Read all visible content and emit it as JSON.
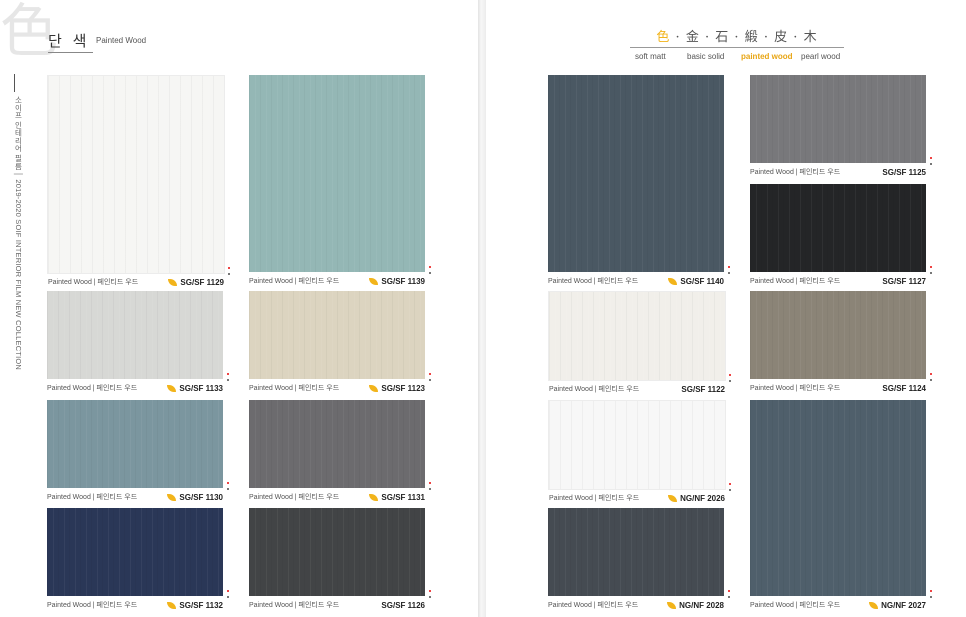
{
  "left_page": {
    "big_char": "色",
    "section_title": "단 색",
    "section_subtitle": "Painted Wood",
    "vertical_text": "소이프 인테리어 필름 │ 2019-2020 SOIF INTERIOR FILM NEW COLLECTION"
  },
  "right_page": {
    "categories_hanja": [
      "色",
      "金",
      "石",
      "緞",
      "皮",
      "木"
    ],
    "category_sep": "·",
    "categories": [
      "soft matt",
      "basic solid",
      "painted wood",
      "pearl wood"
    ],
    "active_category": "painted wood"
  },
  "caption_brand": "Painted Wood  |  페인티드 우드",
  "swatches": [
    {
      "id": "s1129",
      "code": "SG/SF 1129",
      "color": "#f6f6f4",
      "eco": true
    },
    {
      "id": "s1139",
      "code": "SG/SF 1139",
      "color": "#94b7b5",
      "eco": true
    },
    {
      "id": "s1133",
      "code": "SG/SF 1133",
      "color": "#d7d8d5",
      "eco": true
    },
    {
      "id": "s1123",
      "code": "SG/SF 1123",
      "color": "#dcd4c0",
      "eco": true
    },
    {
      "id": "s1130",
      "code": "SG/SF 1130",
      "color": "#7b969f",
      "eco": true
    },
    {
      "id": "s1131",
      "code": "SG/SF 1131",
      "color": "#6c6b6e",
      "eco": true
    },
    {
      "id": "s1132",
      "code": "SG/SF 1132",
      "color": "#2a3757",
      "eco": true
    },
    {
      "id": "s1126",
      "code": "SG/SF 1126",
      "color": "#424446",
      "eco": false
    },
    {
      "id": "s1140",
      "code": "SG/SF 1140",
      "color": "#4a5863",
      "eco": true
    },
    {
      "id": "s1125",
      "code": "SG/SF 1125",
      "color": "#78787b",
      "eco": false
    },
    {
      "id": "s1127",
      "code": "SG/SF 1127",
      "color": "#242527",
      "eco": false
    },
    {
      "id": "s1122",
      "code": "SG/SF 1122",
      "color": "#f1efea",
      "eco": false
    },
    {
      "id": "s1124",
      "code": "SG/SF 1124",
      "color": "#8b8477",
      "eco": false
    },
    {
      "id": "s2026",
      "code": "NG/NF 2026",
      "color": "#f7f7f7",
      "eco": true
    },
    {
      "id": "s2028",
      "code": "NG/NF 2028",
      "color": "#454b52",
      "eco": true
    },
    {
      "id": "s2027",
      "code": "NG/NF 2027",
      "color": "#4f5f6b",
      "eco": true
    }
  ]
}
